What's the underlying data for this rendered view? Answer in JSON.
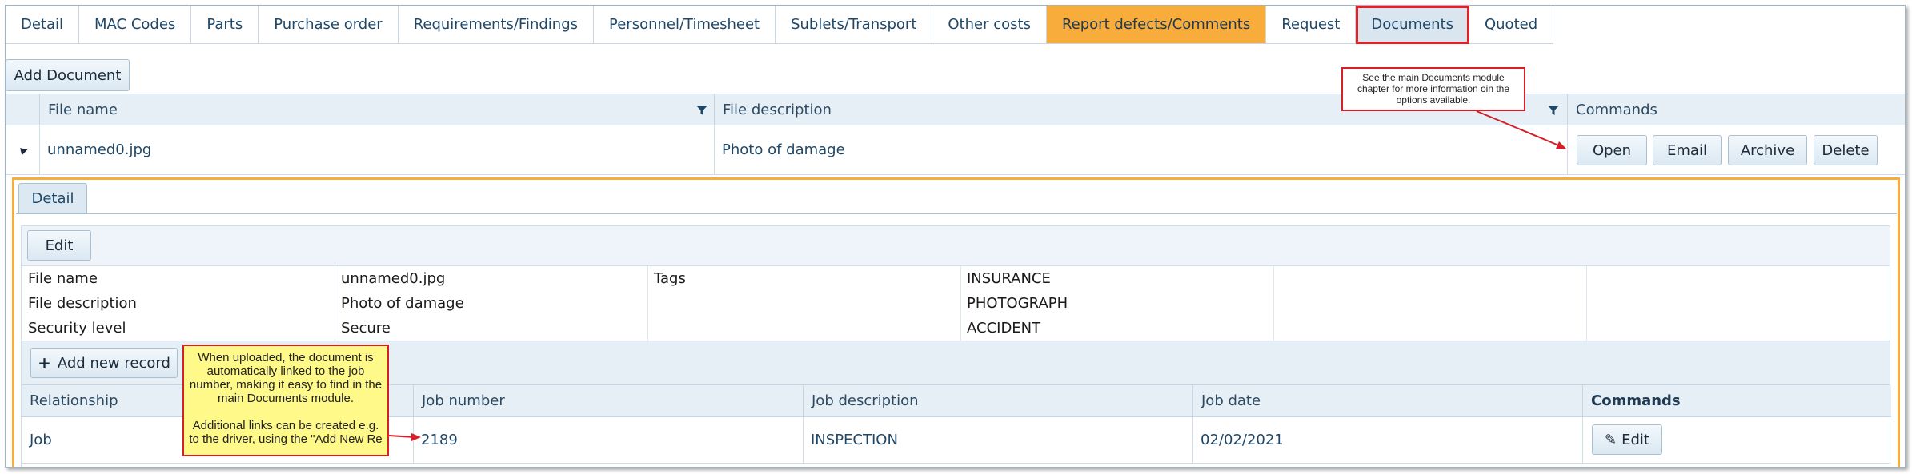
{
  "tabs": [
    {
      "label": "Detail",
      "state": "normal"
    },
    {
      "label": "MAC Codes",
      "state": "normal"
    },
    {
      "label": "Parts",
      "state": "normal"
    },
    {
      "label": "Purchase order",
      "state": "normal"
    },
    {
      "label": "Requirements/Findings",
      "state": "normal"
    },
    {
      "label": "Personnel/Timesheet",
      "state": "normal"
    },
    {
      "label": "Sublets/Transport",
      "state": "normal"
    },
    {
      "label": "Other costs",
      "state": "normal"
    },
    {
      "label": "Report defects/Comments",
      "state": "active"
    },
    {
      "label": "Request",
      "state": "normal"
    },
    {
      "label": "Documents",
      "state": "highlighted"
    },
    {
      "label": "Quoted",
      "state": "normal"
    }
  ],
  "toolbar": {
    "add_document": "Add Document"
  },
  "documents_grid": {
    "columns": {
      "file_name": "File name",
      "file_description": "File description",
      "commands": "Commands"
    },
    "row": {
      "file_name": "unnamed0.jpg",
      "file_description": "Photo of damage",
      "commands": {
        "open": "Open",
        "email": "Email",
        "archive": "Archive",
        "delete": "Delete"
      }
    }
  },
  "detail": {
    "tab_label": "Detail",
    "edit_label": "Edit",
    "fields": {
      "file_name_label": "File name",
      "file_name_value": "unnamed0.jpg",
      "file_description_label": "File description",
      "file_description_value": "Photo of damage",
      "security_level_label": "Security level",
      "security_level_value": "Secure",
      "tags_label": "Tags",
      "tags": [
        "INSURANCE",
        "PHOTOGRAPH",
        "ACCIDENT"
      ]
    },
    "add_new_record": "Add new record",
    "links_grid": {
      "columns": {
        "relationship": "Relationship",
        "job_number": "Job number",
        "job_description": "Job description",
        "job_date": "Job date",
        "commands": "Commands"
      },
      "row": {
        "relationship": "Job",
        "job_number": "2189",
        "job_description": "INSPECTION",
        "job_date": "02/02/2021",
        "edit": "Edit"
      }
    }
  },
  "annotations": {
    "commands_note": "See the main Documents module chapter for more information oin the options available.",
    "upload_note_1": "When uploaded, the document is automatically linked to the job number, making it easy to find in the main Documents module.",
    "upload_note_2": "Additional links can be created e.g. to the driver, using the \"Add New Re"
  },
  "colors": {
    "active_tab": "#f8ac3c",
    "highlight_border": "#e2202a",
    "header_bg": "#e6eff6",
    "link_text": "#1f4868",
    "note_yellow": "#fff98a"
  }
}
